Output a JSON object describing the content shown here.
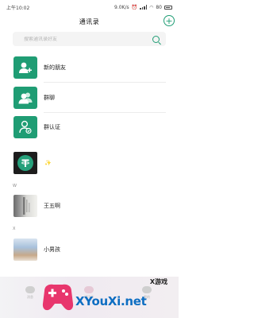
{
  "status_bar": {
    "time": "上午10:02",
    "network_speed": "9.0K/s",
    "battery": "80"
  },
  "header": {
    "title": "通讯录",
    "add_symbol": "+"
  },
  "search": {
    "placeholder": "搜索通讯录好友"
  },
  "entries": [
    {
      "label": "新的朋友",
      "icon": "add-friend-icon"
    },
    {
      "label": "群聊",
      "icon": "group-chat-icon"
    },
    {
      "label": "群认证",
      "icon": "group-verify-icon"
    }
  ],
  "contacts": {
    "first_contact_emoji": "✨",
    "sections": [
      {
        "letter": "W",
        "contacts": [
          {
            "name": "王五啊"
          }
        ]
      },
      {
        "letter": "X",
        "contacts": [
          {
            "name": "小男孩"
          }
        ]
      }
    ]
  },
  "bottom_nav": {
    "items": [
      {
        "label": "消息",
        "icon": "message-icon"
      },
      {
        "label": "通讯录",
        "icon": "contacts-icon"
      },
      {
        "label": "我的",
        "icon": "profile-icon"
      }
    ]
  },
  "watermark": {
    "site": "XYouXi.net",
    "brand_cn": "X游戏"
  },
  "colors": {
    "accent": "#1f9d74",
    "tether": "#26a17b",
    "watermark_blue": "#0e6ec2",
    "watermark_pink": "#e8366d"
  }
}
